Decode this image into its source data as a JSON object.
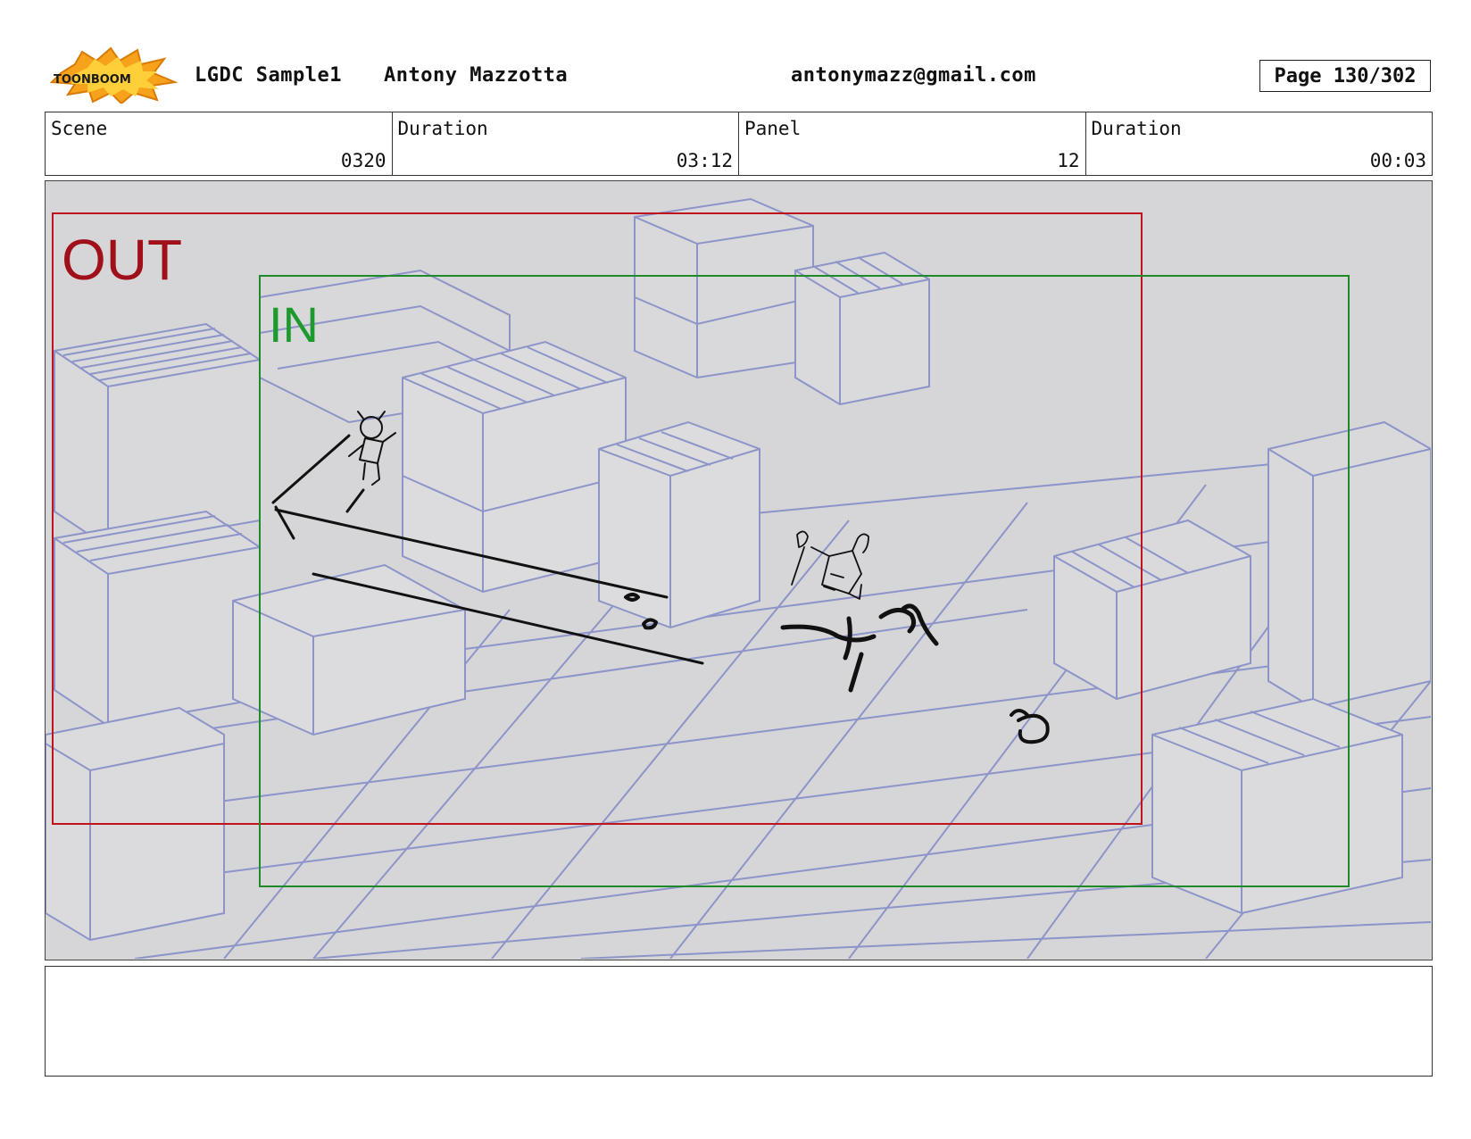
{
  "header": {
    "logo_text": "TOONBOOM",
    "project": "LGDC Sample1",
    "author": "Antony Mazzotta",
    "email": "antonymazz@gmail.com",
    "page": "Page 130/302"
  },
  "info": {
    "scene_label": "Scene",
    "scene_value": "0320",
    "scene_duration_label": "Duration",
    "scene_duration_value": "03:12",
    "panel_label": "Panel",
    "panel_value": "12",
    "panel_duration_label": "Duration",
    "panel_duration_value": "00:03"
  },
  "panel": {
    "out_label": "OUT",
    "in_label": "IN",
    "colors": {
      "out_frame": "#c0141c",
      "in_frame": "#1e8a2a",
      "background_lines": "#8d94c8",
      "background_fill": "#d6d6d8",
      "sketch": "#111111"
    }
  },
  "notes": {
    "text": ""
  }
}
